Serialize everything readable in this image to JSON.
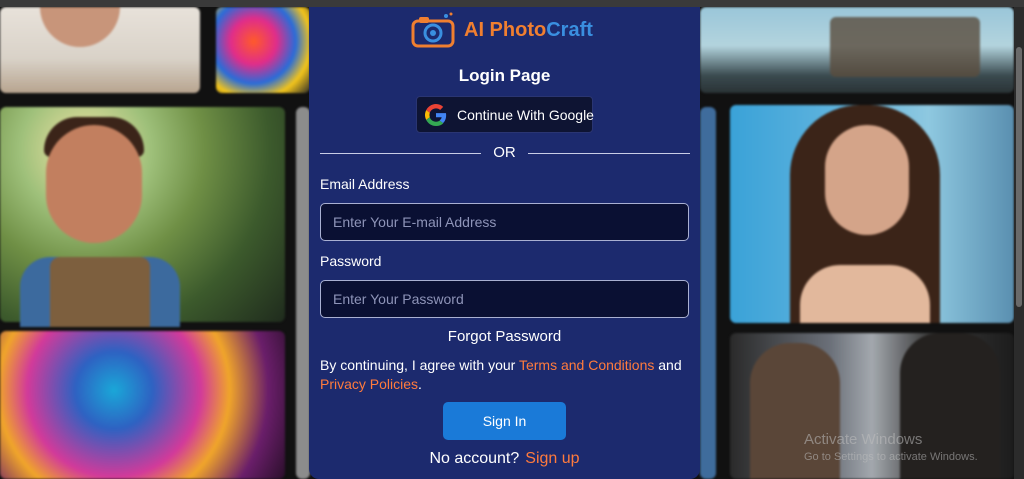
{
  "brand": {
    "name_part1": "AI Photo",
    "name_part2": "Craft",
    "icon": "camera-logo-icon"
  },
  "login": {
    "title": "Login Page",
    "google_button_label": "Continue With Google",
    "google_icon": "google-g-icon",
    "divider_text": "OR",
    "email_label": "Email Address",
    "email_placeholder": "Enter Your E-mail Address",
    "email_value": "",
    "password_label": "Password",
    "password_placeholder": "Enter Your Password",
    "password_value": "",
    "forgot_label": "Forgot Password",
    "consent_prefix": "By continuing, I agree with your ",
    "terms_link": "Terms and Conditions",
    "consent_and": " and ",
    "privacy_link": "Privacy Policies",
    "consent_suffix": ".",
    "signin_label": "Sign In",
    "no_account_text": "No account?",
    "signup_link": "Sign up"
  },
  "watermark": {
    "line1": "Activate Windows",
    "line2": "Go to Settings to activate Windows."
  },
  "colors": {
    "card_bg": "#1c2a6e",
    "accent_orange": "#ff7b3d",
    "signin_blue": "#1a7ad8",
    "logo_orange": "#f07f30",
    "logo_blue": "#3a8fe0"
  }
}
